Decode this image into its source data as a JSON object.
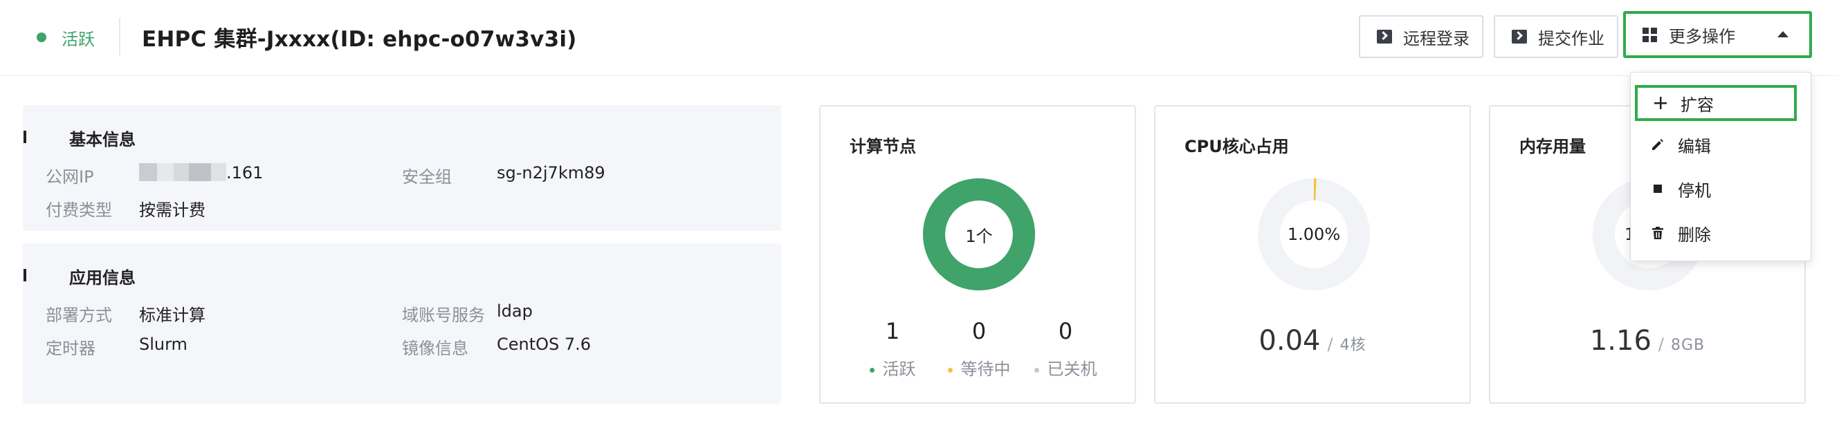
{
  "header": {
    "status": "活跃",
    "cluster_title": "EHPC 集群-Jxxxx(ID: ehpc-o07w3v3i)",
    "remote_login": "远程登录",
    "submit_job": "提交作业",
    "more_actions": "更多操作"
  },
  "basic_info": {
    "title": "基本信息",
    "public_ip_label": "公网IP",
    "public_ip_suffix": ".161",
    "security_group_label": "安全组",
    "security_group_value": "sg-n2j7km89",
    "billing_label": "付费类型",
    "billing_value": "按需计费"
  },
  "app_info": {
    "title": "应用信息",
    "deploy_label": "部署方式",
    "deploy_value": "标准计算",
    "domain_label": "域账号服务",
    "domain_value": "ldap",
    "scheduler_label": "定时器",
    "scheduler_value": "Slurm",
    "image_label": "镜像信息",
    "image_value": "CentOS 7.6"
  },
  "compute_nodes": {
    "title": "计算节点",
    "center": "1个",
    "active_count": "1",
    "pending_count": "0",
    "stopped_count": "0",
    "active_label": "活跃",
    "pending_label": "等待中",
    "stopped_label": "已关机",
    "active_fraction": 1.0
  },
  "cpu": {
    "title": "CPU核心占用",
    "center": "1.00%",
    "used": "0.04",
    "total": "4核",
    "fraction": 0.01
  },
  "memory": {
    "title": "内存用量",
    "center_partial": "14",
    "used": "1.16",
    "total": "8GB",
    "fraction": 0.145
  },
  "dropdown": {
    "items": [
      {
        "label": "扩容"
      },
      {
        "label": "编辑"
      },
      {
        "label": "停机"
      },
      {
        "label": "删除"
      }
    ]
  },
  "colors": {
    "active": "#3fa36a",
    "pending": "#f5c242",
    "stopped": "#c3c6cc",
    "highlight_border": "#2eac4b",
    "track": "#f2f3f6"
  },
  "icons": {
    "remote_login": "terminal-icon",
    "submit_job": "terminal-icon",
    "more_actions": "grid-icon",
    "expand": "plus-icon",
    "edit": "pencil-icon",
    "stop": "stop-icon",
    "delete": "trash-icon"
  }
}
